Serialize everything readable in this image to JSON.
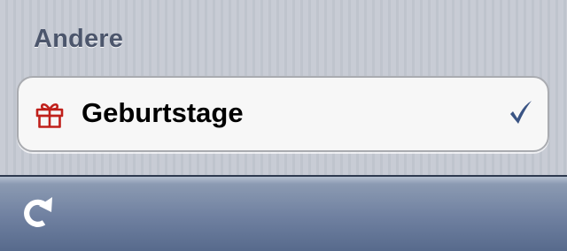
{
  "section": {
    "title": "Andere"
  },
  "rows": [
    {
      "label": "Geburtstage",
      "icon": "gift-icon",
      "checked": true,
      "icon_color": "#c0201b",
      "check_color": "#3a5484"
    }
  ],
  "toolbar": {
    "refresh_icon": "refresh-icon"
  }
}
